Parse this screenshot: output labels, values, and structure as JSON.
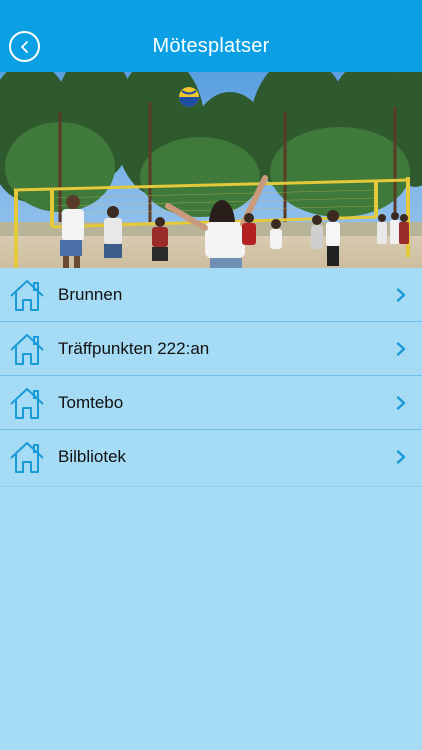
{
  "header": {
    "title": "Mötesplatser",
    "back_icon": "chevron-left-circle-icon"
  },
  "hero": {
    "description_icon": "volleyball-photo"
  },
  "places": [
    {
      "label": "Brunnen",
      "icon": "home-icon"
    },
    {
      "label": "Träffpunkten 222:an",
      "icon": "home-icon"
    },
    {
      "label": "Tomtebo",
      "icon": "home-icon"
    },
    {
      "label": "Bilbliotek",
      "icon": "home-icon"
    }
  ],
  "colors": {
    "header": "#0aa0e3",
    "background": "#a5dbf5",
    "accent": "#1a9ad6"
  }
}
